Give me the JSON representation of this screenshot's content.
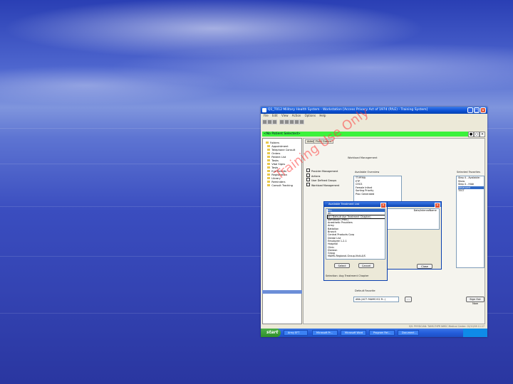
{
  "window": {
    "title": "Q1_T012 Military Health System - Workstation [Access Privacy Act of 1974 (P/LE) - Training System]",
    "menu": [
      "File",
      "Edit",
      "View",
      "Action",
      "Options",
      "Help"
    ],
    "minimize": "_",
    "maximize": "□",
    "close": "×"
  },
  "patient_bar": {
    "text": "<No Patient Selected>"
  },
  "watermark": "Training Use Only",
  "left_tree": {
    "items": [
      "Folders",
      "Appointment",
      "Telephone Consult",
      "Orders",
      "Patient List",
      "Tasks",
      "Vital Signs",
      "Tests",
      "Eye Results",
      "Registration",
      "Library",
      "Reminders",
      "Consult Tracking"
    ]
  },
  "tabs": [
    "Admin",
    "Fluid Orders"
  ],
  "sections": {
    "workload": "Workload Management",
    "available": "Available Overview",
    "selected": "Selected Favorites",
    "default": "Default Favorite"
  },
  "options_list": [
    "Provider Management",
    "Actions",
    "User Defined Groups",
    "Workload Management"
  ],
  "available_list": [
    "TT:PFMA",
    "ETP",
    "CHCS",
    "Female Infant",
    "Sorting Priority",
    "Proc Generated"
  ],
  "selected_list": [
    "Step 4 - Available: Show",
    "Step 4 - Hide",
    "Advanced",
    "TEST"
  ],
  "default_field": "ABA (ACT: MAMS IS2 Fr..)",
  "buttons": {
    "browse": "...",
    "signout": "Sign Out Now",
    "select": "Select",
    "cancel": "Cancel",
    "close": "Close"
  },
  "dialog_main": {
    "title": "Available Treatment List",
    "filter": "",
    "list": [
      "ALL",
      "All...",
      "All (Default Ave Treatment Chapter)",
      "Admission (Prov.)",
      "Anesthetic Providers",
      "Army",
      "Battalion",
      "Branch",
      "Central Products Corp",
      "Dental List",
      "Employee 1-2-1",
      "Hospital",
      "Clinic",
      "Division",
      "Group",
      "MAMS-Regional-Group-Visit-A/S"
    ],
    "selected_index": 2,
    "footer": "Selection: Avg Treatment Chapter"
  },
  "dialog_back": {
    "title": "",
    "columns": [
      "",
      "",
      "Data/Interval",
      "Name"
    ],
    "close_label": "Close"
  },
  "status": "S/S: PHYSICIAN: TAMS-THPR    NMSC Medical Center: 02/10/09 11:17",
  "taskbar": {
    "start": "start",
    "tasks": [
      "Army EFT",
      "Microsoft Pr...",
      "Microsoft Word",
      "Program Rel...",
      "Document..."
    ]
  }
}
